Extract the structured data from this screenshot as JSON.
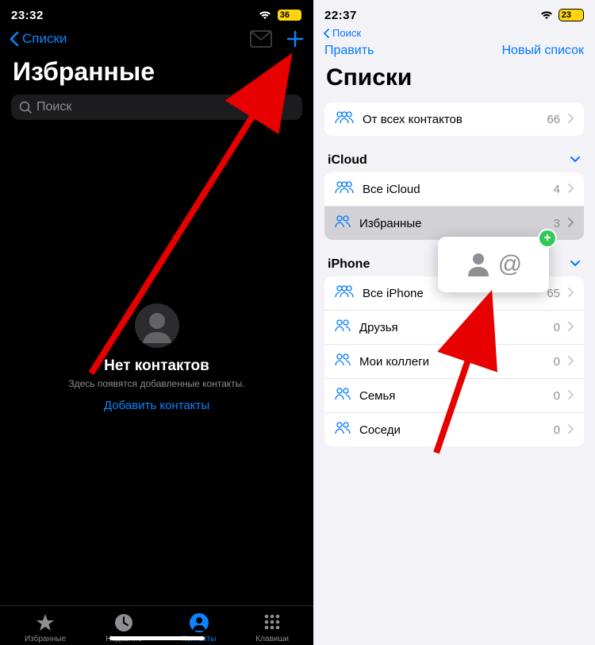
{
  "left": {
    "status": {
      "time": "23:32",
      "battery": "36"
    },
    "back_label": "Списки",
    "title": "Избранные",
    "search_placeholder": "Поиск",
    "empty": {
      "title": "Нет контактов",
      "subtitle": "Здесь появятся добавленные контакты.",
      "add_label": "Добавить контакты"
    },
    "tabs": {
      "fav": "Избранные",
      "recent": "Недавние",
      "contacts": "Контакты",
      "keypad": "Клавиши"
    }
  },
  "right": {
    "status": {
      "time": "22:37",
      "battery": "23"
    },
    "search_back": "Поиск",
    "edit": "Править",
    "new_list": "Новый список",
    "title": "Списки",
    "row_all": {
      "label": "От всех контактов",
      "count": "66"
    },
    "section_icloud": "iCloud",
    "rows_icloud": {
      "all": {
        "label": "Все iCloud",
        "count": "4"
      },
      "fav": {
        "label": "Избранные",
        "count": "3"
      }
    },
    "section_iphone": "iPhone",
    "rows_iphone": {
      "all": {
        "label": "Все iPhone",
        "count": "65"
      },
      "friends": {
        "label": "Друзья",
        "count": "0"
      },
      "colleagues": {
        "label": "Мои коллеги",
        "count": "0"
      },
      "family": {
        "label": "Семья",
        "count": "0"
      },
      "neighbors": {
        "label": "Соседи",
        "count": "0"
      }
    }
  },
  "icons": {
    "at": "@"
  },
  "colors": {
    "ios_blue_dark": "#0a84ff",
    "ios_blue_light": "#007aff",
    "ios_gray": "#8e8e93",
    "ios_green": "#34c759",
    "arrow_red": "#e60000"
  }
}
